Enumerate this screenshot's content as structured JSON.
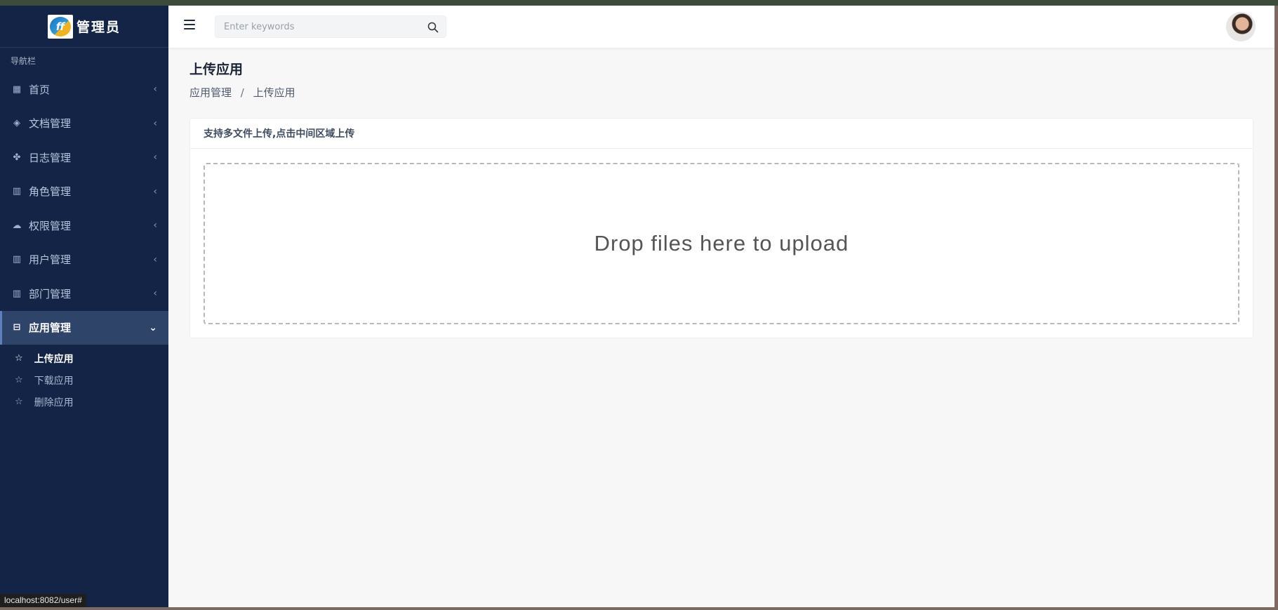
{
  "brand": {
    "name": "管理员",
    "logo_text": "ff"
  },
  "sidebar": {
    "heading": "导航栏",
    "items": [
      {
        "label": "首页",
        "icon": "dashboard-icon",
        "glyph": "▦"
      },
      {
        "label": "文档管理",
        "icon": "layers-icon",
        "glyph": "◈"
      },
      {
        "label": "日志管理",
        "icon": "gamepad-icon",
        "glyph": "✤"
      },
      {
        "label": "角色管理",
        "icon": "bar-chart-icon",
        "glyph": "▥"
      },
      {
        "label": "权限管理",
        "icon": "cloud-check-icon",
        "glyph": "☁"
      },
      {
        "label": "用户管理",
        "icon": "bar-chart-icon",
        "glyph": "▥"
      },
      {
        "label": "部门管理",
        "icon": "bar-chart-icon",
        "glyph": "▥"
      },
      {
        "label": "应用管理",
        "icon": "briefcase-icon",
        "glyph": "⊟"
      }
    ],
    "sub_items": [
      {
        "label": "上传应用",
        "icon": "star-icon"
      },
      {
        "label": "下载应用",
        "icon": "star-icon"
      },
      {
        "label": "删除应用",
        "icon": "star-icon"
      }
    ]
  },
  "header": {
    "search_placeholder": "Enter keywords"
  },
  "main": {
    "title": "上传应用",
    "breadcrumb": [
      "应用管理",
      "上传应用"
    ],
    "breadcrumb_separator": "/",
    "card_title": "支持多文件上传,点击中间区域上传",
    "dropzone_text": "Drop files here to upload"
  },
  "statusbar": {
    "url": "localhost:8082/user#"
  },
  "colors": {
    "sidebar_bg": "#132446",
    "sidebar_active_bg": "#2e4469",
    "content_bg": "#f7f7f7"
  }
}
